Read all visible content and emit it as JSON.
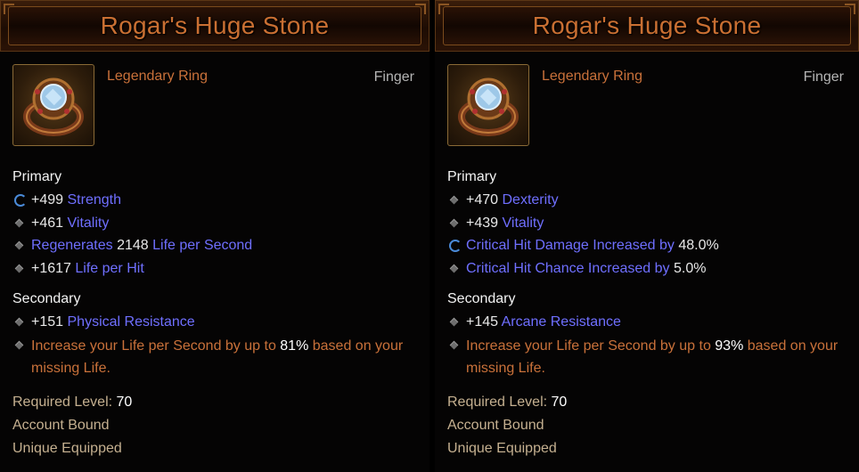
{
  "cards": [
    {
      "title": "Rogar's Huge Stone",
      "type": "Legendary Ring",
      "slot": "Finger",
      "primary_label": "Primary",
      "primary": [
        {
          "icon": "cycle-icon",
          "value": "+499",
          "stat": "Strength"
        },
        {
          "icon": "diamond-icon",
          "value": "+461",
          "stat": "Vitality"
        },
        {
          "icon": "diamond-icon",
          "prefix": "Regenerates",
          "value": "2148",
          "stat": "Life per Second"
        },
        {
          "icon": "diamond-icon",
          "value": "+1617",
          "stat": "Life per Hit"
        }
      ],
      "secondary_label": "Secondary",
      "secondary": [
        {
          "icon": "diamond-icon",
          "value": "+151",
          "stat": "Physical Resistance"
        }
      ],
      "legendary": {
        "before": "Increase your Life per Second by up to ",
        "value": "81%",
        "after": " based on your",
        "line2": "missing Life."
      },
      "required_level_label": "Required Level:",
      "required_level": "70",
      "bound": "Account Bound",
      "unique": "Unique Equipped"
    },
    {
      "title": "Rogar's Huge Stone",
      "type": "Legendary Ring",
      "slot": "Finger",
      "primary_label": "Primary",
      "primary": [
        {
          "icon": "diamond-icon",
          "value": "+470",
          "stat": "Dexterity"
        },
        {
          "icon": "diamond-icon",
          "value": "+439",
          "stat": "Vitality"
        },
        {
          "icon": "cycle-icon",
          "stat": "Critical Hit Damage Increased by",
          "value": "48.0%"
        },
        {
          "icon": "diamond-icon",
          "stat": "Critical Hit Chance Increased by",
          "value": "5.0%"
        }
      ],
      "secondary_label": "Secondary",
      "secondary": [
        {
          "icon": "diamond-icon",
          "value": "+145",
          "stat": "Arcane Resistance"
        }
      ],
      "legendary": {
        "before": "Increase your Life per Second by up to ",
        "value": "93%",
        "after": " based on your",
        "line2": "missing Life."
      },
      "required_level_label": "Required Level:",
      "required_level": "70",
      "bound": "Account Bound",
      "unique": "Unique Equipped"
    }
  ]
}
